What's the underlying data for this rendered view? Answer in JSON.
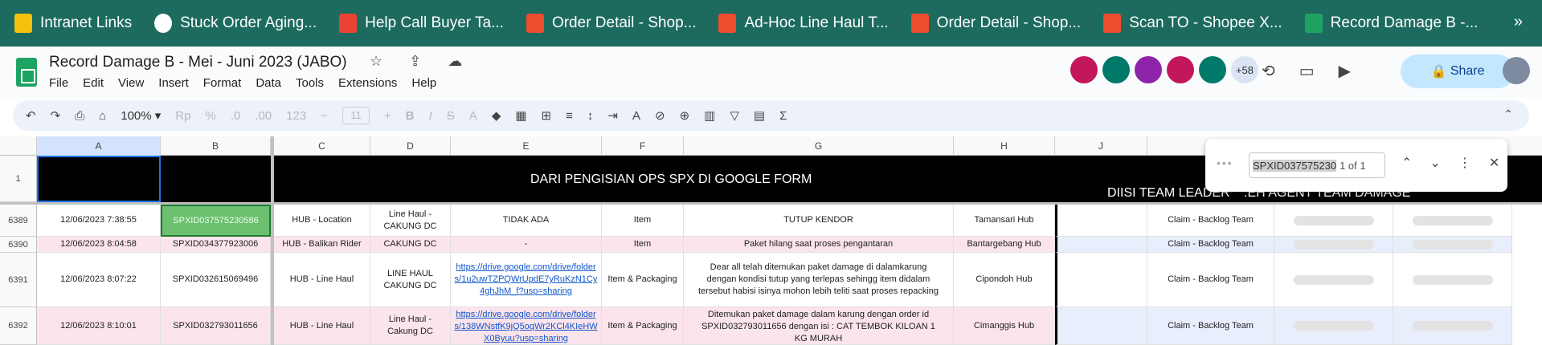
{
  "bookmarks": [
    {
      "label": "Intranet Links",
      "color": "#f4c20d"
    },
    {
      "label": "Stuck Order Aging...",
      "color": "#ffffff"
    },
    {
      "label": "Help Call Buyer Ta...",
      "color": "#ea4335"
    },
    {
      "label": "Order Detail - Shop...",
      "color": "#ee4d2d"
    },
    {
      "label": "Ad-Hoc Line Haul T...",
      "color": "#ee4d2d"
    },
    {
      "label": "Order Detail - Shop...",
      "color": "#ee4d2d"
    },
    {
      "label": "Scan TO - Shopee X...",
      "color": "#ee4d2d"
    },
    {
      "label": "Record Damage B -...",
      "color": "#1ea362"
    }
  ],
  "bookmarks_more": "»",
  "doc": {
    "title": "Record Damage B - Mei - Juni 2023 (JABO)",
    "title_icons": "☆ ⇪ ☁"
  },
  "menus": [
    "File",
    "Edit",
    "View",
    "Insert",
    "Format",
    "Data",
    "Tools",
    "Extensions",
    "Help"
  ],
  "collaborators": {
    "colors": [
      "#c2185b",
      "#00796b",
      "#8e24aa",
      "#c2185b",
      "#00796b"
    ],
    "more": "+58"
  },
  "header_icons": {
    "history": "⟲",
    "comments": "▭",
    "meet": "▶"
  },
  "share_label": "Share",
  "toolbar": {
    "undo": "↶",
    "redo": "↷",
    "print": "⎙",
    "paint": "⌂",
    "zoom": "100% ▾",
    "rp": "Rp",
    "percent": "%",
    "dec_less": ".0",
    "dec_more": ".00",
    "format_123": "123",
    "minus": "−",
    "font_size": "11",
    "plus": "+",
    "bold": "B",
    "italic": "I",
    "strike": "S",
    "text_color": "A",
    "fill": "◆",
    "borders": "▦",
    "merge": "⊞",
    "halign": "≡",
    "valign": "↕",
    "wrap": "⇥",
    "rotate": "A",
    "link": "⊘",
    "comment": "⊕",
    "chart": "▥",
    "filter": "▽",
    "views": "▤",
    "functions": "Σ",
    "collapse": "⌃"
  },
  "columns": [
    "A",
    "B",
    "C",
    "D",
    "E",
    "F",
    "G",
    "H",
    "J"
  ],
  "header_row": {
    "num": "1",
    "banner": "DARI PENGISIAN OPS SPX DI GOOGLE FORM",
    "team_leader": "DIISI TEAM LEADER",
    "agent": ".EH AGENT TEAM DAMAGE"
  },
  "rows": [
    {
      "num": "6389",
      "a": "12/06/2023 7:38:55",
      "b": "SPXID037575230586",
      "c": "HUB - Location",
      "d": "Line Haul - CAKUNG DC",
      "e": "TIDAK ADA",
      "f": "Item",
      "g": "TUTUP KENDOR",
      "h": "Tamansari Hub",
      "k": "Claim - Backlog Team"
    },
    {
      "num": "6390",
      "a": "12/06/2023 8:04:58",
      "b": "SPXID034377923006",
      "c": "HUB - Balikan Rider",
      "d": "CAKUNG DC",
      "e": "-",
      "f": "Item",
      "g": "Paket hilang saat proses pengantaran",
      "h": "Bantargebang Hub",
      "k": "Claim - Backlog Team"
    },
    {
      "num": "6391",
      "a": "12/06/2023 8:07:22",
      "b": "SPXID032615069496",
      "c": "HUB - Line Haul",
      "d": "LINE HAUL CAKUNG DC",
      "e": "https://drive.google.com/drive/folders/1u2uwTZPQWrUpdE7yRuKzN1Cy4ghJhM_f?usp=sharing",
      "f": "Item & Packaging",
      "g": "Dear all telah ditemukan paket damage di dalamkarung dengan kondisi tutup yang terlepas sehingg item didalam tersebut habisi isinya mohon lebih teliti saat proses repacking",
      "h": "Cipondoh Hub",
      "k": "Claim - Backlog Team"
    },
    {
      "num": "6392",
      "a": "12/06/2023 8:10:01",
      "b": "SPXID032793011656",
      "c": "HUB - Line Haul",
      "d": "Line Haul - Cakung DC",
      "e": "https://drive.google.com/drive/folders/138WNstfK9jQ5oqWr2KCl4KIeHWX0Byuu?usp=sharing",
      "f": "Item & Packaging",
      "g": "Ditemukan paket damage dalam karung dengan order id SPXID032793011656 dengan isi : CAT TEMBOK KILOAN 1 KG MURAH",
      "h": "Cimanggis Hub",
      "k": "Claim - Backlog Team"
    }
  ],
  "find": {
    "query": "SPXID037575230",
    "count": "1 of 1",
    "dots": "•••",
    "up": "⌃",
    "down": "⌄",
    "more": "⋮",
    "close": "✕"
  }
}
